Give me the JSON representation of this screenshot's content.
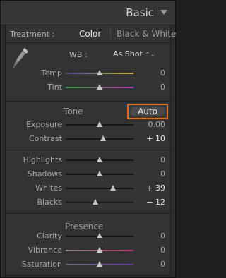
{
  "header": {
    "title": "Basic"
  },
  "treatment": {
    "label": "Treatment :",
    "options": [
      "Color",
      "Black & White"
    ]
  },
  "wb": {
    "label": "WB :",
    "value": "As Shot",
    "arrows": "⌃⌄"
  },
  "groups": {
    "tone": {
      "title": "Tone",
      "auto_label": "Auto"
    },
    "presence": {
      "title": "Presence"
    }
  },
  "sliders": [
    {
      "id": "temp",
      "label": "Temp",
      "value": "0",
      "level": 0.5,
      "highlight": false,
      "gradient": [
        "#3e4a9a",
        "#c8b43a"
      ]
    },
    {
      "id": "tint",
      "label": "Tint",
      "value": "0",
      "level": 0.5,
      "highlight": false,
      "gradient": [
        "#3a9a44",
        "#b33ab0"
      ]
    },
    {
      "id": "exposure",
      "label": "Exposure",
      "value": "0.00",
      "level": 0.5,
      "highlight": false
    },
    {
      "id": "contrast",
      "label": "Contrast",
      "value": "+ 10",
      "level": 0.55,
      "highlight": true
    },
    {
      "id": "highlights",
      "label": "Highlights",
      "value": "0",
      "level": 0.5,
      "highlight": false
    },
    {
      "id": "shadows",
      "label": "Shadows",
      "value": "0",
      "level": 0.5,
      "highlight": false
    },
    {
      "id": "whites",
      "label": "Whites",
      "value": "+ 39",
      "level": 0.695,
      "highlight": true
    },
    {
      "id": "blacks",
      "label": "Blacks",
      "value": "− 12",
      "level": 0.44,
      "highlight": true
    },
    {
      "id": "clarity",
      "label": "Clarity",
      "value": "0",
      "level": 0.5,
      "highlight": false
    },
    {
      "id": "vibrance",
      "label": "Vibrance",
      "value": "0",
      "level": 0.5,
      "highlight": false,
      "gradient": [
        "#8a8a8a",
        "#b0306a"
      ]
    },
    {
      "id": "saturation",
      "label": "Saturation",
      "value": "0",
      "level": 0.5,
      "highlight": false,
      "gradient": [
        "#707070",
        "#6b3cb0"
      ]
    }
  ]
}
